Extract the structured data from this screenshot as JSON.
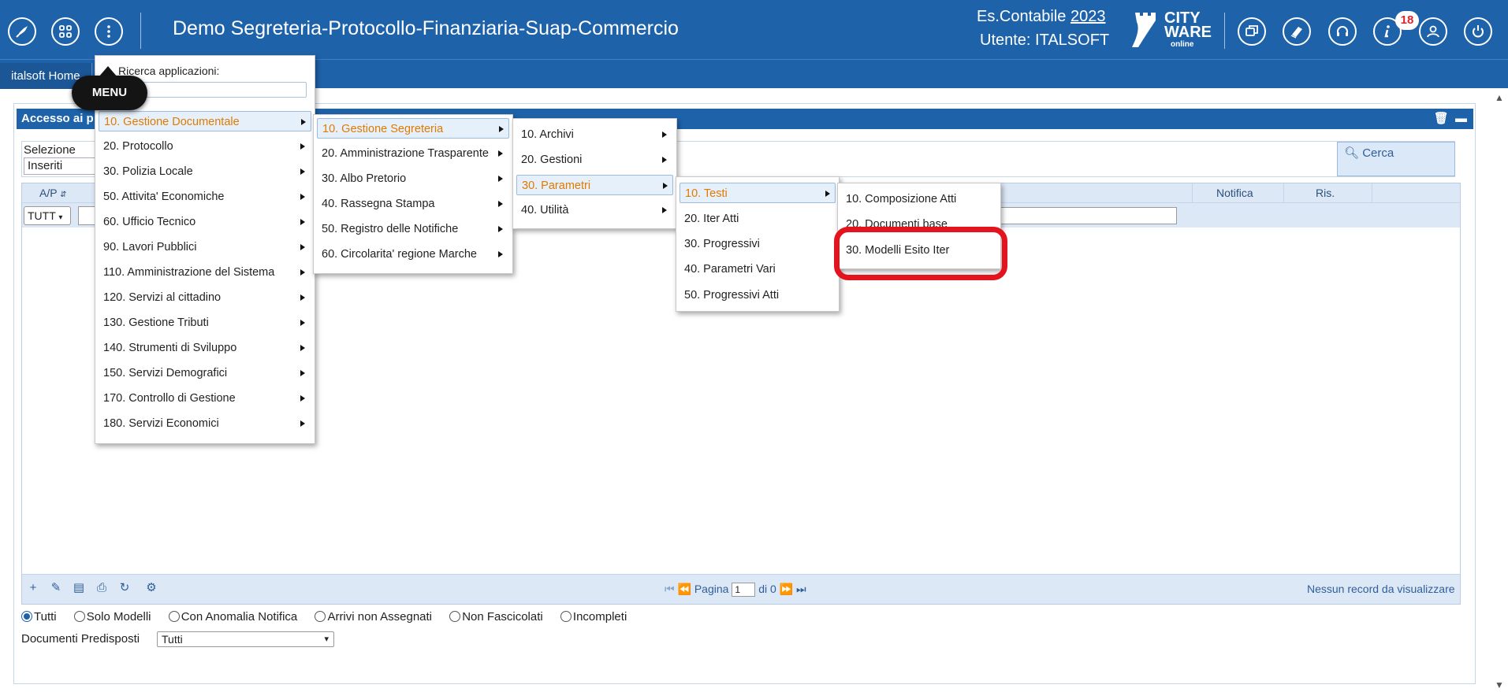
{
  "header": {
    "app_title": "Demo Segreteria-Protocollo-Finanziaria-Suap-Commercio",
    "es_label": "Es.Contabile",
    "es_year": "2023",
    "user_line": "Utente: ITALSOFT",
    "logo": {
      "line1": "CITY",
      "line2": "WARE",
      "line3": "online"
    },
    "notification_count": "18",
    "icons": [
      "rocket-icon",
      "apps-grid-icon",
      "more-vertical-icon",
      "windows-icon",
      "book-icon",
      "headset-icon",
      "info-icon",
      "user-icon",
      "power-icon"
    ]
  },
  "tabs": {
    "home": "italsoft Home"
  },
  "panel": {
    "title": "Accesso ai p",
    "selezione_label": "Selezione",
    "selezione_value": "Inseriti",
    "cerca_label": "Cerca",
    "columns": {
      "ap": "A/P",
      "notifica": "Notifica",
      "ris": "Ris."
    },
    "filter_value": "TUTT",
    "pager": {
      "label": "Pagina",
      "page": "1",
      "of": "di 0"
    },
    "no_records": "Nessun record da visualizzare",
    "radio_options": [
      "Tutti",
      "Solo Modelli",
      "Con Anomalia Notifica",
      "Arrivi non Assegnati",
      "Non Fascicolati",
      "Incompleti"
    ],
    "radio_selected": "Tutti",
    "doc_pred_label": "Documenti Predisposti",
    "doc_pred_value": "Tutti"
  },
  "menu": {
    "badge": "MENU",
    "search_label": "Ricerca applicazioni:",
    "level1": [
      "10. Gestione Documentale",
      "20. Protocollo",
      "30. Polizia Locale",
      "50. Attivita' Economiche",
      "60. Ufficio Tecnico",
      "90. Lavori Pubblici",
      "110. Amministrazione del Sistema",
      "120. Servizi al cittadino",
      "130. Gestione Tributi",
      "140. Strumenti di Sviluppo",
      "150. Servizi Demografici",
      "170. Controllo di Gestione",
      "180. Servizi Economici"
    ],
    "level2": [
      "10. Gestione Segreteria",
      "20. Amministrazione Trasparente",
      "30. Albo Pretorio",
      "40. Rassegna Stampa",
      "50. Registro delle Notifiche",
      "60. Circolarita' regione Marche"
    ],
    "level3": [
      "10. Archivi",
      "20. Gestioni",
      "30. Parametri",
      "40. Utilità"
    ],
    "level4": [
      "10. Testi",
      "20. Iter Atti",
      "30. Progressivi",
      "40. Parametri Vari",
      "50. Progressivi Atti"
    ],
    "level5": [
      "10. Composizione Atti",
      "20. Documenti base",
      "30. Modelli Esito Iter"
    ]
  },
  "colors": {
    "brand": "#1e62aa",
    "active_text": "#e07a00",
    "highlight": "#e3141d"
  }
}
